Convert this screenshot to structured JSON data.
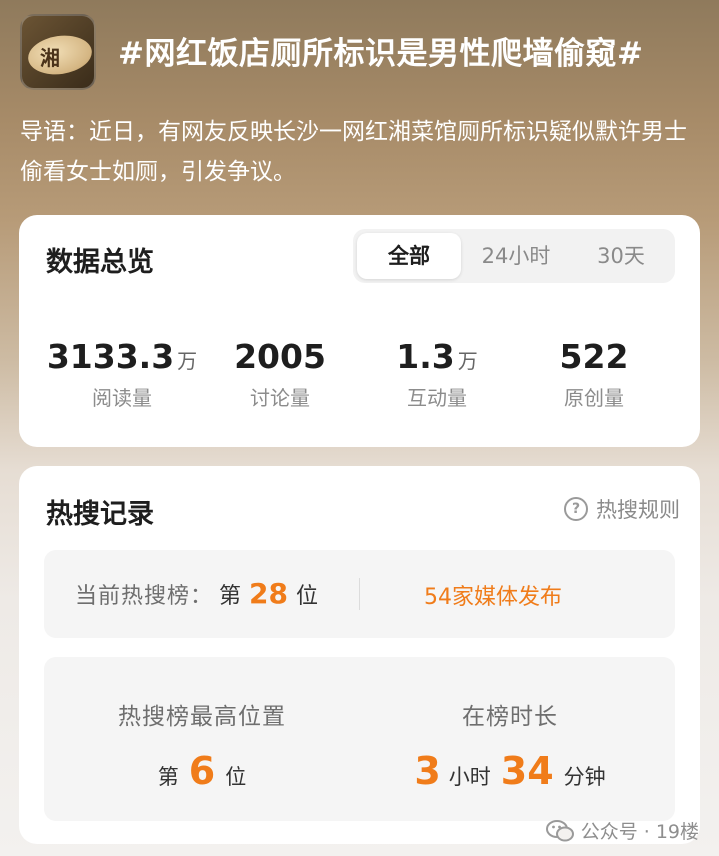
{
  "header": {
    "logo_text": "湘",
    "title": "#网红饭店厕所标识是男性爬墙偷窥#",
    "intro": "导语：近日，有网友反映长沙一网红湘菜馆厕所标识疑似默许男士偷看女士如厕，引发争议。"
  },
  "overview": {
    "title": "数据总览",
    "tabs": [
      {
        "label": "全部",
        "active": true
      },
      {
        "label": "24小时",
        "active": false
      },
      {
        "label": "30天",
        "active": false
      }
    ],
    "stats": [
      {
        "value": "3133.3",
        "unit": "万",
        "label": "阅读量"
      },
      {
        "value": "2005",
        "unit": "",
        "label": "讨论量"
      },
      {
        "value": "1.3",
        "unit": "万",
        "label": "互动量"
      },
      {
        "value": "522",
        "unit": "",
        "label": "原创量"
      }
    ]
  },
  "records": {
    "title": "热搜记录",
    "rules_label": "热搜规则",
    "current": {
      "label": "当前热搜榜：",
      "prefix": "第",
      "rank": "28",
      "suffix": "位",
      "media": "54家媒体发布"
    },
    "best": {
      "label": "热搜榜最高位置",
      "prefix": "第",
      "rank": "6",
      "suffix": "位"
    },
    "duration": {
      "label": "在榜时长",
      "hours": "3",
      "hours_unit": "小时",
      "minutes": "34",
      "minutes_unit": "分钟"
    }
  },
  "watermark": "公众号 · 19楼",
  "colors": {
    "accent": "#f07c1a",
    "card": "#ffffff",
    "panel": "#f5f5f5"
  }
}
